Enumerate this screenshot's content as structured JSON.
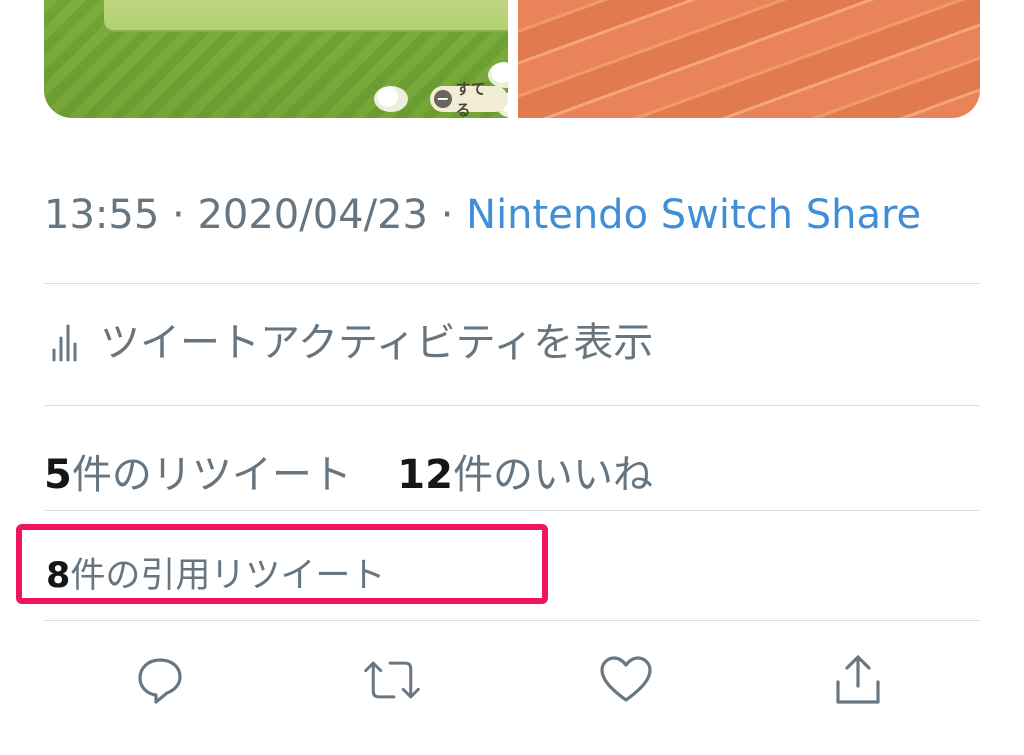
{
  "media": {
    "left_tag_label": "すてる",
    "left_tag_close": "X"
  },
  "meta": {
    "time": "13:55",
    "separator": "·",
    "date": "2020/04/23",
    "source": "Nintendo Switch Share"
  },
  "activity": {
    "icon": "bar-chart-icon",
    "label": "ツイートアクティビティを表示"
  },
  "stats": {
    "retweet_count": "5",
    "retweet_label": "件のリツイート",
    "like_count": "12",
    "like_label": "件のいいね"
  },
  "quote": {
    "count": "8",
    "label": "件の引用リツイート"
  },
  "actions": [
    {
      "icon": "reply-icon"
    },
    {
      "icon": "retweet-icon"
    },
    {
      "icon": "like-icon"
    },
    {
      "icon": "share-icon"
    }
  ],
  "colors": {
    "link": "#3e8ed8",
    "secondary_text": "#66757f",
    "primary_text": "#14171a",
    "highlight": "#f0145a",
    "divider": "#dcdfe2",
    "icon": "#687782"
  }
}
